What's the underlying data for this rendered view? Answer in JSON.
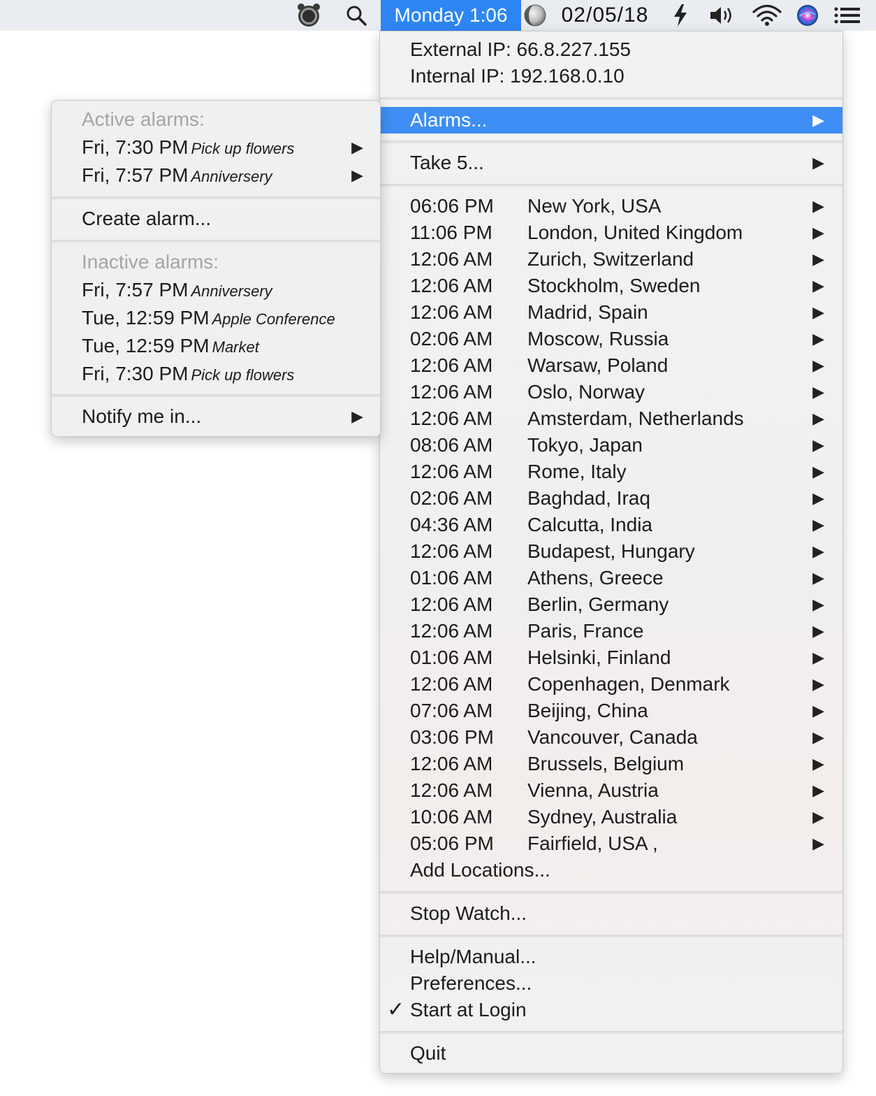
{
  "menubar": {
    "clock": "Monday 1:06",
    "date": "02/05/18",
    "icons": [
      "alarm-clock-icon",
      "search-icon",
      "moon-icon",
      "battery-bolt-icon",
      "volume-icon",
      "wifi-icon",
      "siri-icon",
      "notification-list-icon"
    ],
    "accent": "#2e86f5"
  },
  "main_menu": {
    "external_ip": "External IP: 66.8.227.155",
    "internal_ip": "Internal IP: 192.168.0.10",
    "alarms": "Alarms...",
    "take5": "Take 5...",
    "locations": [
      {
        "time": "06:06 PM",
        "city": "New York, USA"
      },
      {
        "time": "11:06 PM",
        "city": "London, United Kingdom"
      },
      {
        "time": "12:06 AM",
        "city": "Zurich, Switzerland"
      },
      {
        "time": "12:06 AM",
        "city": "Stockholm, Sweden"
      },
      {
        "time": "12:06 AM",
        "city": "Madrid, Spain"
      },
      {
        "time": "02:06 AM",
        "city": "Moscow, Russia"
      },
      {
        "time": "12:06 AM",
        "city": "Warsaw, Poland"
      },
      {
        "time": "12:06 AM",
        "city": "Oslo, Norway"
      },
      {
        "time": "12:06 AM",
        "city": "Amsterdam, Netherlands"
      },
      {
        "time": "08:06 AM",
        "city": "Tokyo, Japan"
      },
      {
        "time": "12:06 AM",
        "city": "Rome, Italy"
      },
      {
        "time": "02:06 AM",
        "city": "Baghdad, Iraq"
      },
      {
        "time": "04:36 AM",
        "city": "Calcutta, India"
      },
      {
        "time": "12:06 AM",
        "city": "Budapest, Hungary"
      },
      {
        "time": "01:06 AM",
        "city": "Athens, Greece"
      },
      {
        "time": "12:06 AM",
        "city": "Berlin, Germany"
      },
      {
        "time": "12:06 AM",
        "city": "Paris, France"
      },
      {
        "time": "01:06 AM",
        "city": "Helsinki, Finland"
      },
      {
        "time": "12:06 AM",
        "city": "Copenhagen, Denmark"
      },
      {
        "time": "07:06 AM",
        "city": "Beijing, China"
      },
      {
        "time": "03:06 PM",
        "city": "Vancouver, Canada"
      },
      {
        "time": "12:06 AM",
        "city": "Brussels, Belgium"
      },
      {
        "time": "12:06 AM",
        "city": "Vienna, Austria"
      },
      {
        "time": "10:06 AM",
        "city": "Sydney, Australia"
      },
      {
        "time": "05:06 PM",
        "city": "Fairfield, USA      ,"
      }
    ],
    "add_locations": "Add Locations...",
    "stop_watch": "Stop Watch...",
    "help": "Help/Manual...",
    "preferences": "Preferences...",
    "start_at_login": "Start at Login",
    "start_at_login_checked": true,
    "quit": "Quit",
    "highlight_color": "#3f8ef5"
  },
  "alarms_menu": {
    "active_header": "Active alarms:",
    "active": [
      {
        "when": "Fri, 7:30 PM",
        "note": "Pick up flowers"
      },
      {
        "when": "Fri, 7:57 PM",
        "note": "Anniversery"
      }
    ],
    "create": "Create alarm...",
    "inactive_header": "Inactive alarms:",
    "inactive": [
      {
        "when": "Fri, 7:57 PM",
        "note": "Anniversery"
      },
      {
        "when": "Tue, 12:59 PM",
        "note": "Apple Conference"
      },
      {
        "when": "Tue, 12:59 PM",
        "note": "Market"
      },
      {
        "when": "Fri, 7:30 PM",
        "note": "Pick up flowers"
      }
    ],
    "notify": "Notify me in..."
  }
}
